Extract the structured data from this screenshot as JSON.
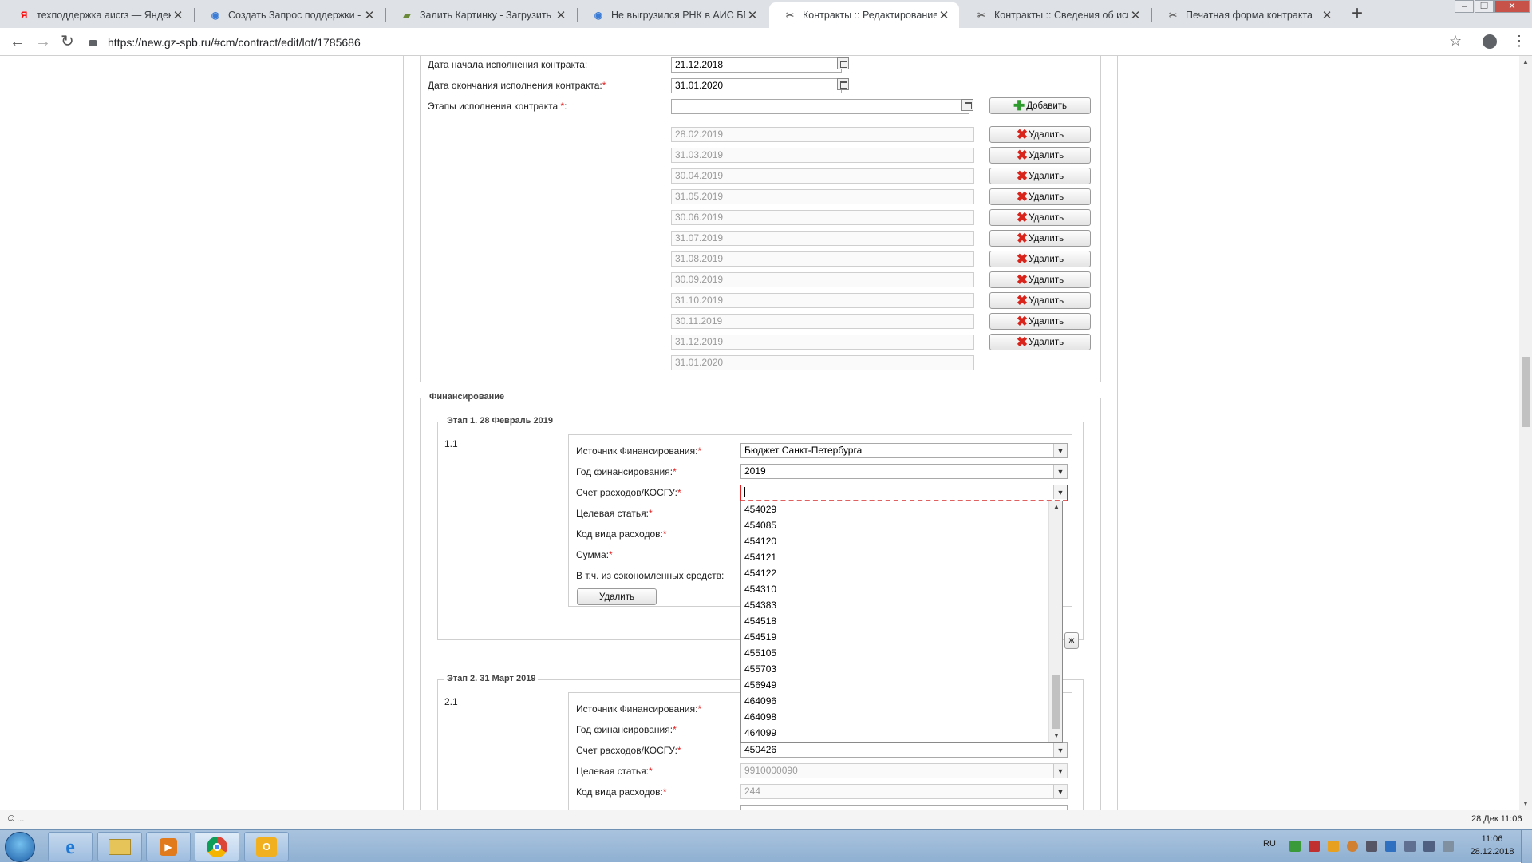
{
  "browser": {
    "tabs": [
      {
        "title": "техподдержка аисгз — Яндекс",
        "icon": "yandex-icon",
        "icon_glyph": "Я",
        "icon_color": "#ff0000",
        "active": false
      },
      {
        "title": "Создать Запрос поддержки - АИ",
        "icon": "globe-icon",
        "icon_glyph": "◉",
        "icon_color": "#3a7bd5",
        "active": false
      },
      {
        "title": "Залить Картинку - Загрузить фо",
        "icon": "image-host-icon",
        "icon_glyph": "▰",
        "icon_color": "#6a8a3a",
        "active": false
      },
      {
        "title": "Не выгрузился РНК в АИС БП-Э",
        "icon": "globe-icon",
        "icon_glyph": "◉",
        "icon_color": "#3a7bd5",
        "active": false
      },
      {
        "title": "Контракты :: Редактирование ко",
        "icon": "tools-icon",
        "icon_glyph": "✂",
        "icon_color": "#666666",
        "active": true
      },
      {
        "title": "Контракты :: Сведения об испол",
        "icon": "tools-icon",
        "icon_glyph": "✂",
        "icon_color": "#666666",
        "active": false
      },
      {
        "title": "Печатная форма контракта",
        "icon": "tools-icon",
        "icon_glyph": "✂",
        "icon_color": "#666666",
        "active": false
      }
    ],
    "close_glyph": "✕",
    "new_tab_glyph": "+",
    "url": "https://new.gz-spb.ru/#cm/contract/edit/lot/1785686"
  },
  "form": {
    "start_date_label": "Дата начала исполнения контракта:",
    "start_date_value": "21.12.2018",
    "end_date_label": "Дата окончания исполнения контракта:",
    "end_date_value": "31.01.2020",
    "stages_label": "Этапы исполнения контракта",
    "add_button": "Добавить",
    "delete_button": "Удалить",
    "stage_dates": [
      "28.02.2019",
      "31.03.2019",
      "30.04.2019",
      "31.05.2019",
      "30.06.2019",
      "31.07.2019",
      "31.08.2019",
      "30.09.2019",
      "31.10.2019",
      "30.11.2019",
      "31.12.2019",
      "31.01.2020"
    ]
  },
  "financing": {
    "legend": "Финансирование",
    "stage1": {
      "legend": "Этап 1. 28 Февраль 2019",
      "index": "1.1",
      "source_label": "Источник Финансирования:",
      "source_value": "Бюджет Санкт-Петербурга",
      "year_label": "Год финансирования:",
      "year_value": "2019",
      "account_label": "Счет расходов/КОСГУ:",
      "account_value": "",
      "target_label": "Целевая статья:",
      "expense_label": "Код вида расходов:",
      "sum_label": "Сумма:",
      "savings_label": "В т.ч. из сэкономленных средств:",
      "delete_button": "Удалить"
    },
    "stage2": {
      "legend": "Этап 2. 31 Март 2019",
      "index": "2.1",
      "source_label": "Источник Финансирования:",
      "year_label": "Год финансирования:",
      "account_label": "Счет расходов/КОСГУ:",
      "account_value": "450426",
      "target_label": "Целевая статья:",
      "target_value": "9910000090",
      "expense_label": "Код вида расходов:",
      "expense_value": "244"
    }
  },
  "dropdown": {
    "options": [
      "454029",
      "454085",
      "454120",
      "454121",
      "454122",
      "454310",
      "454383",
      "454518",
      "454519",
      "455105",
      "455703",
      "456949",
      "464096",
      "464098",
      "464099"
    ]
  },
  "status_bar": {
    "left": "© ...",
    "right": "28 Дек 11:06"
  },
  "taskbar": {
    "lang": "RU",
    "time": "11:06",
    "date": "28.12.2018",
    "apps": [
      "ie-icon",
      "explorer-icon",
      "media-player-icon",
      "chrome-icon",
      "outlook-icon"
    ]
  }
}
